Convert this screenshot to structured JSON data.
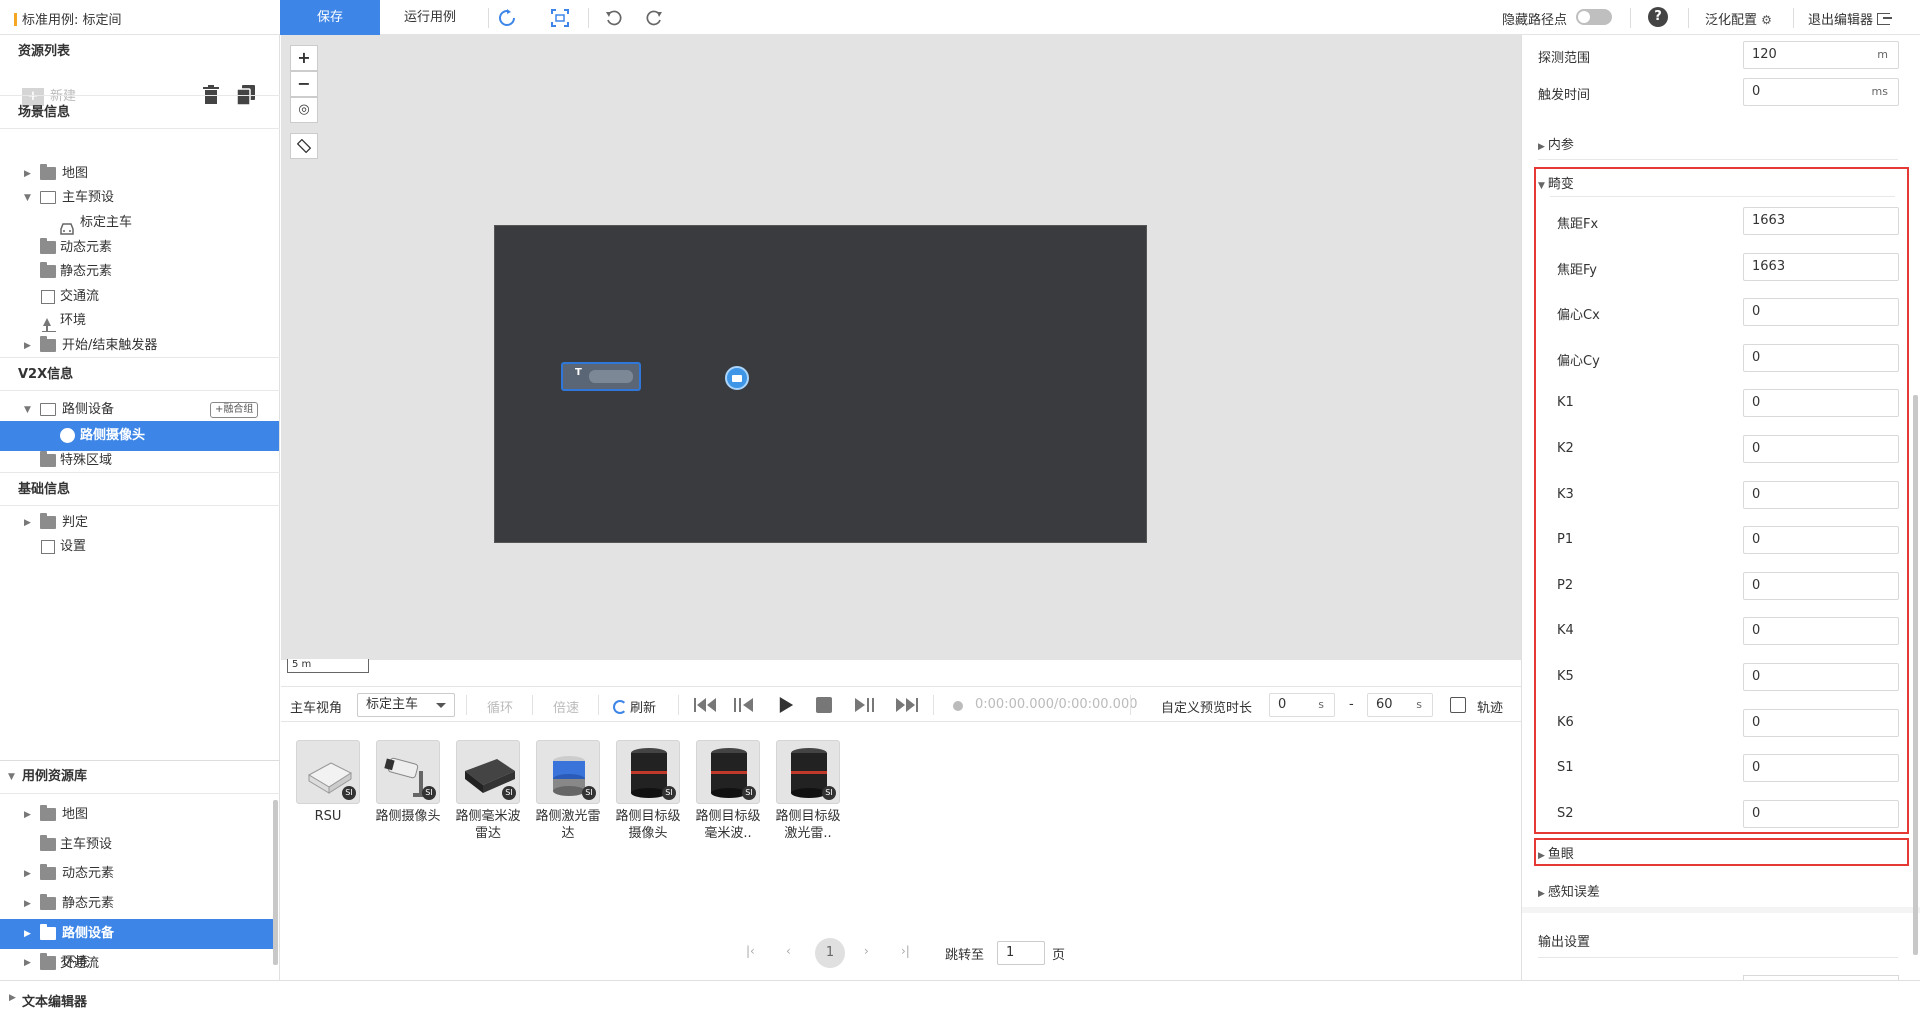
{
  "topbar": {
    "case_title": "标准用例: 标定间",
    "save": "保存",
    "run": "运行用例",
    "hide_path_label": "隐藏路径点",
    "generalize": "泛化配置",
    "exit": "退出编辑器"
  },
  "left": {
    "resource_list": "资源列表",
    "new": "新建",
    "scene_info": "场景信息",
    "scene_items": [
      "地图",
      "主车预设",
      "标定主车",
      "动态元素",
      "静态元素",
      "交通流",
      "环境",
      "开始/结束触发器"
    ],
    "v2x_info": "V2X信息",
    "v2x_items": [
      "路侧设备",
      "路侧摄像头",
      "特殊区域"
    ],
    "merge_group": "+融合组",
    "basic_info": "基础信息",
    "basic_items": [
      "判定",
      "设置"
    ],
    "case_lib": "用例资源库",
    "lib_items": [
      "地图",
      "主车预设",
      "动态元素",
      "静态元素",
      "路侧设备",
      "交通流",
      "环境"
    ],
    "text_editor": "文本编辑器"
  },
  "map": {
    "car_label": "T",
    "scale": "5 m"
  },
  "playbar": {
    "ego_view": "主车视角",
    "view_value": "标定主车",
    "loop": "循环",
    "speed": "倍速",
    "refresh": "刷新",
    "time": "0:00:00.000/0:00:00.000",
    "custom_preview": "自定义预览时长",
    "start_value": "0",
    "end_value": "60",
    "unit_s": "s",
    "dash": "-",
    "track": "轨迹"
  },
  "tiles": [
    {
      "cap": "RSU"
    },
    {
      "cap": "路侧摄像头"
    },
    {
      "cap": "路侧毫米波雷达"
    },
    {
      "cap": "路侧激光雷达"
    },
    {
      "cap": "路侧目标级摄像头"
    },
    {
      "cap": "路侧目标级毫米波.."
    },
    {
      "cap": "路侧目标级激光雷.."
    }
  ],
  "tile_badge": "SI",
  "pager": {
    "current": "1",
    "jump_to": "跳转至",
    "jump_value": "1",
    "page": "页"
  },
  "right": {
    "detect_range_label": "探测范围",
    "detect_range_value": "120",
    "detect_range_unit": "m",
    "trigger_time_label": "触发时间",
    "trigger_time_value": "0",
    "trigger_time_unit": "ms",
    "intrinsics": "内参",
    "distortion": "畸变",
    "distortion_params": [
      {
        "label": "焦距Fx",
        "value": "1663"
      },
      {
        "label": "焦距Fy",
        "value": "1663"
      },
      {
        "label": "偏心Cx",
        "value": "0"
      },
      {
        "label": "偏心Cy",
        "value": "0"
      },
      {
        "label": "K1",
        "value": "0"
      },
      {
        "label": "K2",
        "value": "0"
      },
      {
        "label": "K3",
        "value": "0"
      },
      {
        "label": "P1",
        "value": "0"
      },
      {
        "label": "P2",
        "value": "0"
      },
      {
        "label": "K4",
        "value": "0"
      },
      {
        "label": "K5",
        "value": "0"
      },
      {
        "label": "K6",
        "value": "0"
      },
      {
        "label": "S1",
        "value": "0"
      },
      {
        "label": "S2",
        "value": "0"
      }
    ],
    "fisheye": "鱼眼",
    "perception_error": "感知误差",
    "output_settings": "输出设置"
  },
  "colors": {
    "accent": "#3d86e8",
    "highlight_border": "#e53935",
    "scene_bg": "#3a3b3e"
  }
}
